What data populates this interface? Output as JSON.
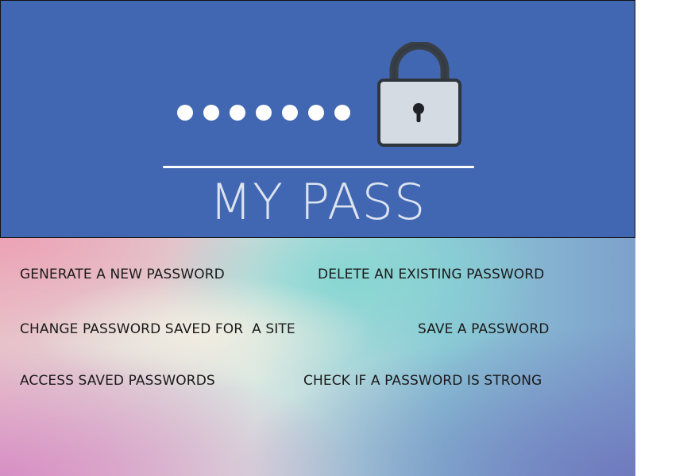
{
  "header": {
    "title": "MY PASS",
    "masked_dots": 7,
    "background_color": "#4267b2",
    "icon": "padlock-icon"
  },
  "menu": {
    "generate": "GENERATE A NEW PASSWORD",
    "delete": "DELETE AN EXISTING PASSWORD",
    "change": "CHANGE PASSWORD SAVED FOR  A SITE",
    "save": "SAVE A PASSWORD",
    "access": "ACCESS SAVED PASSWORDS",
    "check": "CHECK IF A PASSWORD IS STRONG"
  }
}
